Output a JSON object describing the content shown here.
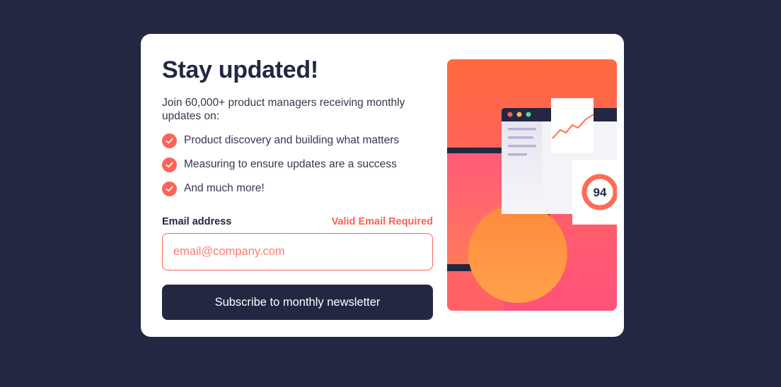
{
  "signup": {
    "title": "Stay updated!",
    "intro": "Join 60,000+ product managers receiving monthly updates on:",
    "features": [
      "Product discovery and building what matters",
      "Measuring to ensure updates are a success",
      "And much more!"
    ],
    "email_label": "Email address",
    "email_error": "Valid Email Required",
    "email_placeholder": "email@company.com",
    "email_value": "",
    "submit_label": "Subscribe to monthly newsletter"
  },
  "illustration": {
    "score": "94"
  },
  "colors": {
    "background": "#242742",
    "card": "#ffffff",
    "accent": "#ff6155",
    "primary": "#242742"
  }
}
